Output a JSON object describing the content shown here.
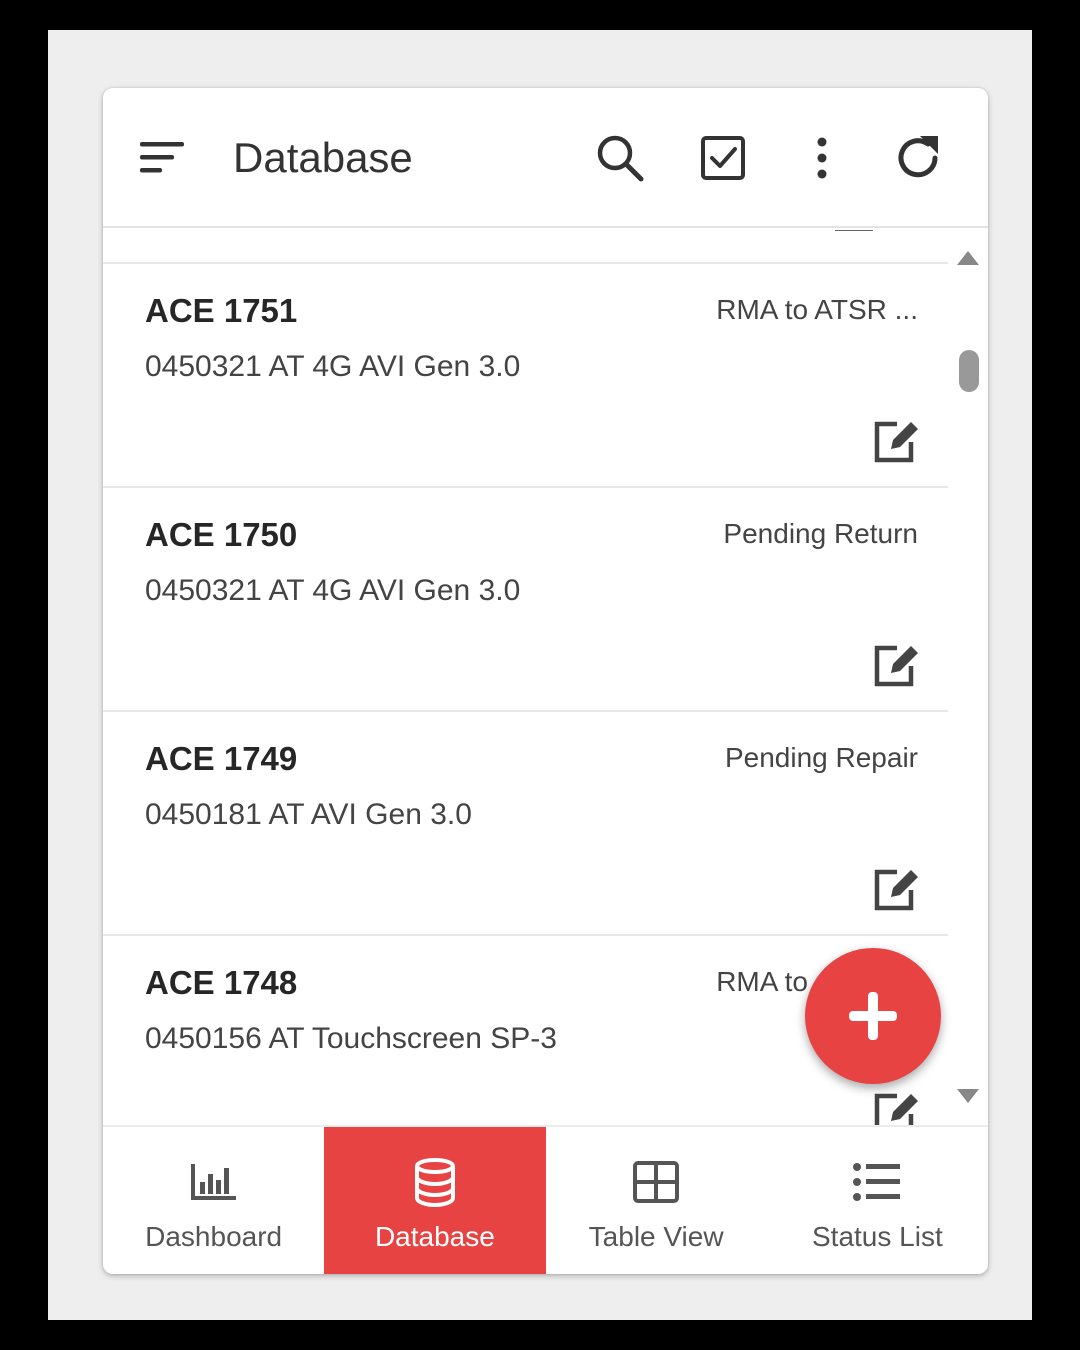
{
  "header": {
    "title": "Database",
    "icons": [
      "menu-sort-icon",
      "search-icon",
      "checkbox-icon",
      "more-vert-icon",
      "refresh-icon"
    ]
  },
  "list": {
    "rows": [
      {
        "id": "ACE 1751",
        "desc": "0450321 AT 4G AVI Gen 3.0",
        "status": "RMA to ATSR ..."
      },
      {
        "id": "ACE 1750",
        "desc": "0450321 AT 4G AVI Gen 3.0",
        "status": "Pending Return"
      },
      {
        "id": "ACE 1749",
        "desc": "0450181 AT AVI Gen 3.0",
        "status": "Pending Repair"
      },
      {
        "id": "ACE 1748",
        "desc": "0450156 AT Touchscreen SP-3",
        "status": "RMA to"
      }
    ]
  },
  "fab": {
    "icon": "plus-icon"
  },
  "nav": {
    "items": [
      {
        "label": "Dashboard",
        "icon": "bar-chart-icon",
        "active": false
      },
      {
        "label": "Database",
        "icon": "database-icon",
        "active": true
      },
      {
        "label": "Table View",
        "icon": "table-grid-icon",
        "active": false
      },
      {
        "label": "Status List",
        "icon": "list-icon",
        "active": false
      }
    ]
  },
  "colors": {
    "accent": "#e84343",
    "text": "#333333",
    "divider": "#e8e8e8"
  }
}
